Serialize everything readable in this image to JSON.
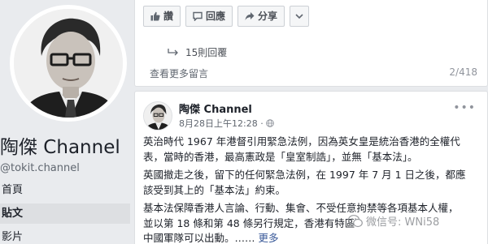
{
  "profile": {
    "page_name": "陶傑 Channel",
    "handle": "@tokit.channel",
    "nav": [
      "首頁",
      "貼文",
      "影片"
    ]
  },
  "top_card": {
    "actions": [
      {
        "icon": "thumbs-up-icon",
        "label": "讚"
      },
      {
        "icon": "comment-icon",
        "label": "回應"
      },
      {
        "icon": "share-icon",
        "label": "分享"
      }
    ],
    "more_icon": "chevron-down-icon",
    "replies_label": "15則回覆",
    "more_comments_label": "查看更多留言",
    "comment_count": "2/418"
  },
  "post": {
    "author": "陶傑 Channel",
    "timestamp": "8月28日上午12:28 ·",
    "audience_icon": "globe-icon",
    "options_icon": "more-dots-icon",
    "paragraphs": [
      [
        "英治時代 1967 年港督引用緊急法例，因為英女皇是統治香港的全權代",
        "表，當時的香港，最高憲政是「皇室制誥」，並無「基本法」。"
      ],
      [
        "英國撤走之後，留下的任何緊急法例，在 1997 年 7 月 1 日之後，都應",
        "該受到其上的「基本法」約束。"
      ],
      [
        "基本法保障香港人言論、行動、集會、不受任意拘禁等各項基本人權，",
        "並以第 18 條和第 48 條另行規定，香港有特區",
        "中國軍隊可以出動。……"
      ]
    ],
    "see_more": "更多"
  },
  "watermark": "微信号: WNi58",
  "colors": {
    "background": "#e9ebee",
    "card": "#ffffff",
    "link": "#385898",
    "muted": "#90949c"
  }
}
